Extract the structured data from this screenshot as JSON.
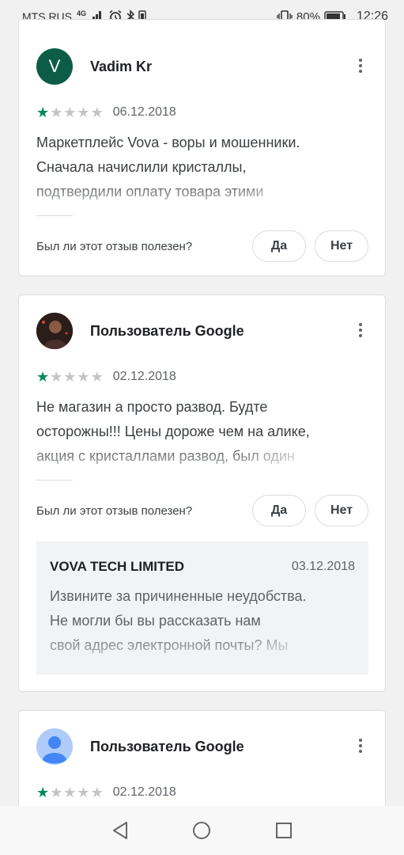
{
  "status_bar": {
    "carrier": "MTS RUS",
    "network": "4G",
    "battery": "80%",
    "time": "12:26"
  },
  "reviews": [
    {
      "avatar_letter": "V",
      "avatar_color": "#0d5c46",
      "name": "Vadim Kr",
      "rating": 1,
      "date": "06.12.2018",
      "text_lines": [
        "Маркетплейс Vova - воры и мошенники.",
        "Сначала начислили кристаллы,",
        "подтвердили оплату товара этими"
      ],
      "helpful_question": "Был ли этот отзыв полезен?",
      "yes_label": "Да",
      "no_label": "Нет"
    },
    {
      "avatar_type": "photo",
      "name": "Пользователь Google",
      "rating": 1,
      "date": "02.12.2018",
      "text_lines": [
        "Не магазин а просто развод. Будте",
        "осторожны!!! Цены дороже чем на алике,",
        "акция с кристаллами развод, был один"
      ],
      "helpful_question": "Был ли этот отзыв полезен?",
      "yes_label": "Да",
      "no_label": "Нет",
      "developer_reply": {
        "developer": "VOVA TECH LIMITED",
        "date": "03.12.2018",
        "text_lines": [
          "Извините за причиненные неудобства.",
          "Не могли бы вы рассказать нам",
          "свой адрес электронной почты? Мы"
        ]
      }
    },
    {
      "avatar_type": "default-user",
      "avatar_color": "#aecbfa",
      "name": "Пользователь Google",
      "rating": 1,
      "date": "02.12.2018"
    }
  ],
  "nav_bar": {
    "buttons": [
      "back-icon",
      "home-icon",
      "recents-icon"
    ]
  }
}
